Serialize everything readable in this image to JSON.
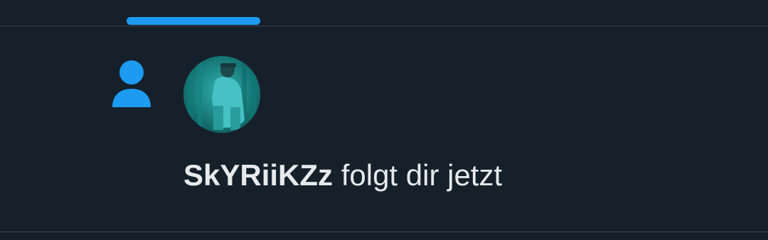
{
  "notification": {
    "icon": "person-icon",
    "avatar": "user-avatar",
    "username": "SkYRiiKZz",
    "action_text": "folgt dir jetzt"
  },
  "colors": {
    "background": "#15202b",
    "accent": "#1d9bf0",
    "divider": "#38444d",
    "text": "#e7e9ea"
  }
}
